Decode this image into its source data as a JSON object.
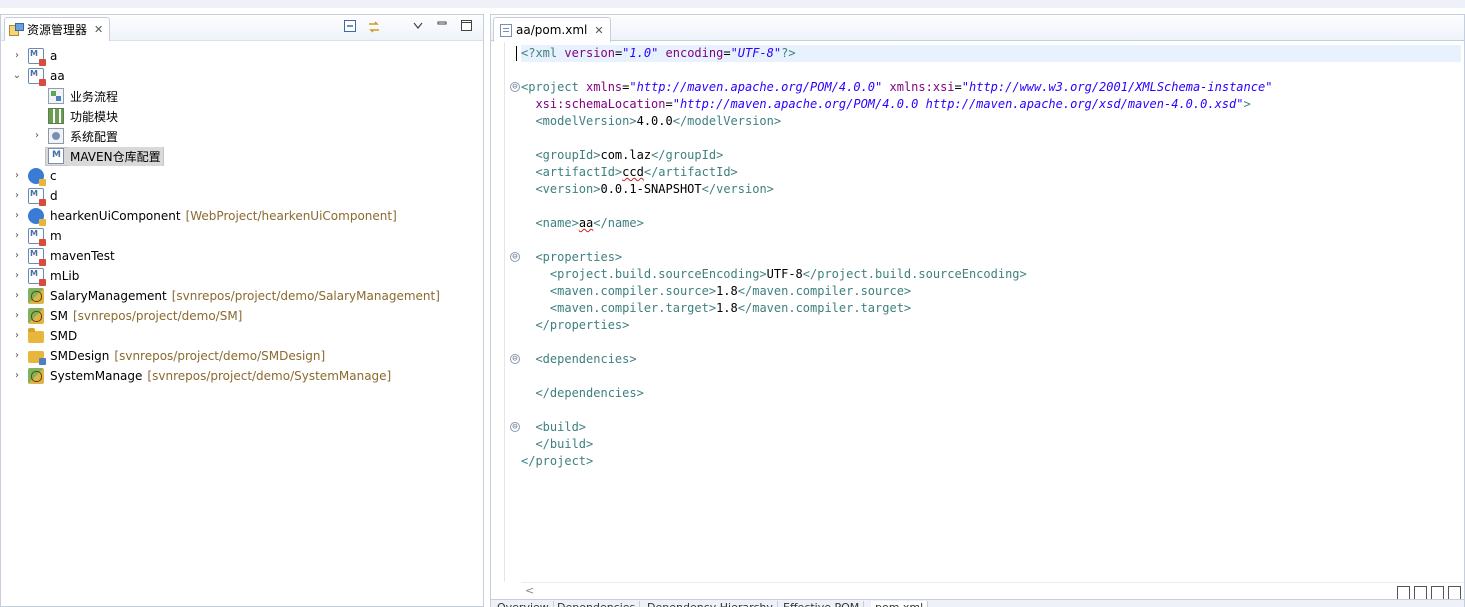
{
  "explorer": {
    "tab_label": "资源管理器",
    "close_symbol": "✕",
    "items": [
      {
        "label": "a",
        "deco": "",
        "icon": "maven-project-icon",
        "indent": 0,
        "twisty": "›"
      },
      {
        "label": "aa",
        "deco": "",
        "icon": "maven-project-icon",
        "indent": 0,
        "twisty": "⌄"
      },
      {
        "label": "业务流程",
        "deco": "",
        "icon": "flow-icon",
        "indent": 1,
        "twisty": ""
      },
      {
        "label": "功能模块",
        "deco": "",
        "icon": "module-icon",
        "indent": 1,
        "twisty": ""
      },
      {
        "label": "系统配置",
        "deco": "",
        "icon": "config-icon",
        "indent": 1,
        "twisty": "›"
      },
      {
        "label": "MAVEN仓库配置",
        "deco": "",
        "icon": "maven-file-icon",
        "indent": 1,
        "twisty": "",
        "selected": true
      },
      {
        "label": "c",
        "deco": "",
        "icon": "web-project-icon",
        "indent": 0,
        "twisty": "›"
      },
      {
        "label": "d",
        "deco": "",
        "icon": "maven-project-icon",
        "indent": 0,
        "twisty": "›"
      },
      {
        "label": "hearkenUiComponent",
        "deco": "[WebProject/hearkenUiComponent]",
        "icon": "web-project-icon",
        "indent": 0,
        "twisty": "›"
      },
      {
        "label": "m",
        "deco": "",
        "icon": "maven-project-icon",
        "indent": 0,
        "twisty": "›"
      },
      {
        "label": "mavenTest",
        "deco": "",
        "icon": "maven-project-icon",
        "indent": 0,
        "twisty": "›"
      },
      {
        "label": "mLib",
        "deco": "",
        "icon": "maven-project-icon",
        "indent": 0,
        "twisty": "›"
      },
      {
        "label": "SalaryManagement",
        "deco": "[svnrepos/project/demo/SalaryManagement]",
        "icon": "package-project-icon",
        "indent": 0,
        "twisty": "›"
      },
      {
        "label": "SM",
        "deco": "[svnrepos/project/demo/SM]",
        "icon": "package-project-icon",
        "indent": 0,
        "twisty": "›"
      },
      {
        "label": "SMD",
        "deco": "",
        "icon": "folder-icon",
        "indent": 0,
        "twisty": "›"
      },
      {
        "label": "SMDesign",
        "deco": "[svnrepos/project/demo/SMDesign]",
        "icon": "folder-package-icon",
        "indent": 0,
        "twisty": "›"
      },
      {
        "label": "SystemManage",
        "deco": "[svnrepos/project/demo/SystemManage]",
        "icon": "package-project-icon",
        "indent": 0,
        "twisty": "›"
      }
    ]
  },
  "editor": {
    "tab_label": "aa/pom.xml",
    "close_symbol": "✕",
    "lines": [
      {
        "fold": "",
        "indent": 0,
        "segments": [
          [
            "pi",
            "<?xml "
          ],
          [
            "attr",
            "version"
          ],
          [
            "txt",
            "="
          ],
          [
            "val",
            "\"1.0\""
          ],
          [
            "txt",
            " "
          ],
          [
            "attr",
            "encoding"
          ],
          [
            "txt",
            "="
          ],
          [
            "val",
            "\"UTF-8\""
          ],
          [
            "pi",
            "?>"
          ]
        ],
        "current": true
      },
      {
        "fold": "",
        "indent": 0,
        "segments": []
      },
      {
        "fold": "⊖",
        "indent": 0,
        "segments": [
          [
            "tag",
            "<project "
          ],
          [
            "attr",
            "xmlns"
          ],
          [
            "txt",
            "="
          ],
          [
            "val",
            "\"http://maven.apache.org/POM/4.0.0\""
          ],
          [
            "txt",
            " "
          ],
          [
            "attr",
            "xmlns:xsi"
          ],
          [
            "txt",
            "="
          ],
          [
            "val",
            "\"http://www.w3.org/2001/XMLSchema-instance\""
          ]
        ]
      },
      {
        "fold": "",
        "indent": 2,
        "segments": [
          [
            "attr",
            "xsi:schemaLocation"
          ],
          [
            "txt",
            "="
          ],
          [
            "val",
            "\"http://maven.apache.org/POM/4.0.0 http://maven.apache.org/xsd/maven-4.0.0.xsd\""
          ],
          [
            "tag",
            ">"
          ]
        ]
      },
      {
        "fold": "",
        "indent": 2,
        "segments": [
          [
            "tag",
            "<modelVersion>"
          ],
          [
            "txt",
            "4.0.0"
          ],
          [
            "tag",
            "</modelVersion>"
          ]
        ]
      },
      {
        "fold": "",
        "indent": 0,
        "segments": []
      },
      {
        "fold": "",
        "indent": 2,
        "segments": [
          [
            "tag",
            "<groupId>"
          ],
          [
            "txt",
            "com.laz"
          ],
          [
            "tag",
            "</groupId>"
          ]
        ]
      },
      {
        "fold": "",
        "indent": 2,
        "segments": [
          [
            "tag",
            "<artifactId>"
          ],
          [
            "sq",
            "ccd"
          ],
          [
            "tag",
            "</artifactId>"
          ]
        ]
      },
      {
        "fold": "",
        "indent": 2,
        "segments": [
          [
            "tag",
            "<version>"
          ],
          [
            "txt",
            "0.0.1-SNAPSHOT"
          ],
          [
            "tag",
            "</version>"
          ]
        ]
      },
      {
        "fold": "",
        "indent": 0,
        "segments": []
      },
      {
        "fold": "",
        "indent": 2,
        "segments": [
          [
            "tag",
            "<name>"
          ],
          [
            "sq",
            "aa"
          ],
          [
            "tag",
            "</name>"
          ]
        ]
      },
      {
        "fold": "",
        "indent": 0,
        "segments": []
      },
      {
        "fold": "⊖",
        "indent": 2,
        "segments": [
          [
            "tag",
            "<properties>"
          ]
        ]
      },
      {
        "fold": "",
        "indent": 4,
        "segments": [
          [
            "tag",
            "<project.build.sourceEncoding>"
          ],
          [
            "txt",
            "UTF-8"
          ],
          [
            "tag",
            "</project.build.sourceEncoding>"
          ]
        ]
      },
      {
        "fold": "",
        "indent": 4,
        "segments": [
          [
            "tag",
            "<maven.compiler.source>"
          ],
          [
            "txt",
            "1.8"
          ],
          [
            "tag",
            "</maven.compiler.source>"
          ]
        ]
      },
      {
        "fold": "",
        "indent": 4,
        "segments": [
          [
            "tag",
            "<maven.compiler.target>"
          ],
          [
            "txt",
            "1.8"
          ],
          [
            "tag",
            "</maven.compiler.target>"
          ]
        ]
      },
      {
        "fold": "",
        "indent": 2,
        "segments": [
          [
            "tag",
            "</properties>"
          ]
        ]
      },
      {
        "fold": "",
        "indent": 0,
        "segments": []
      },
      {
        "fold": "⊖",
        "indent": 2,
        "segments": [
          [
            "tag",
            "<dependencies>"
          ]
        ]
      },
      {
        "fold": "",
        "indent": 0,
        "segments": []
      },
      {
        "fold": "",
        "indent": 2,
        "segments": [
          [
            "tag",
            "</dependencies>"
          ]
        ]
      },
      {
        "fold": "",
        "indent": 0,
        "segments": []
      },
      {
        "fold": "⊖",
        "indent": 2,
        "segments": [
          [
            "tag",
            "<build>"
          ]
        ]
      },
      {
        "fold": "",
        "indent": 2,
        "segments": [
          [
            "tag",
            "</build>"
          ]
        ]
      },
      {
        "fold": "",
        "indent": 0,
        "segments": [
          [
            "tag",
            "</project>"
          ]
        ]
      }
    ],
    "scroll_left_arrow": "<"
  },
  "bottom_tabs": [
    "Overview",
    "Dependencies",
    "Dependency Hierarchy",
    "Effective POM",
    "pom.xml"
  ],
  "colors": {
    "tag": "#3f7f7f",
    "attr": "#7f007f",
    "value": "#2a00ff",
    "decoration": "#8a6a2f"
  }
}
